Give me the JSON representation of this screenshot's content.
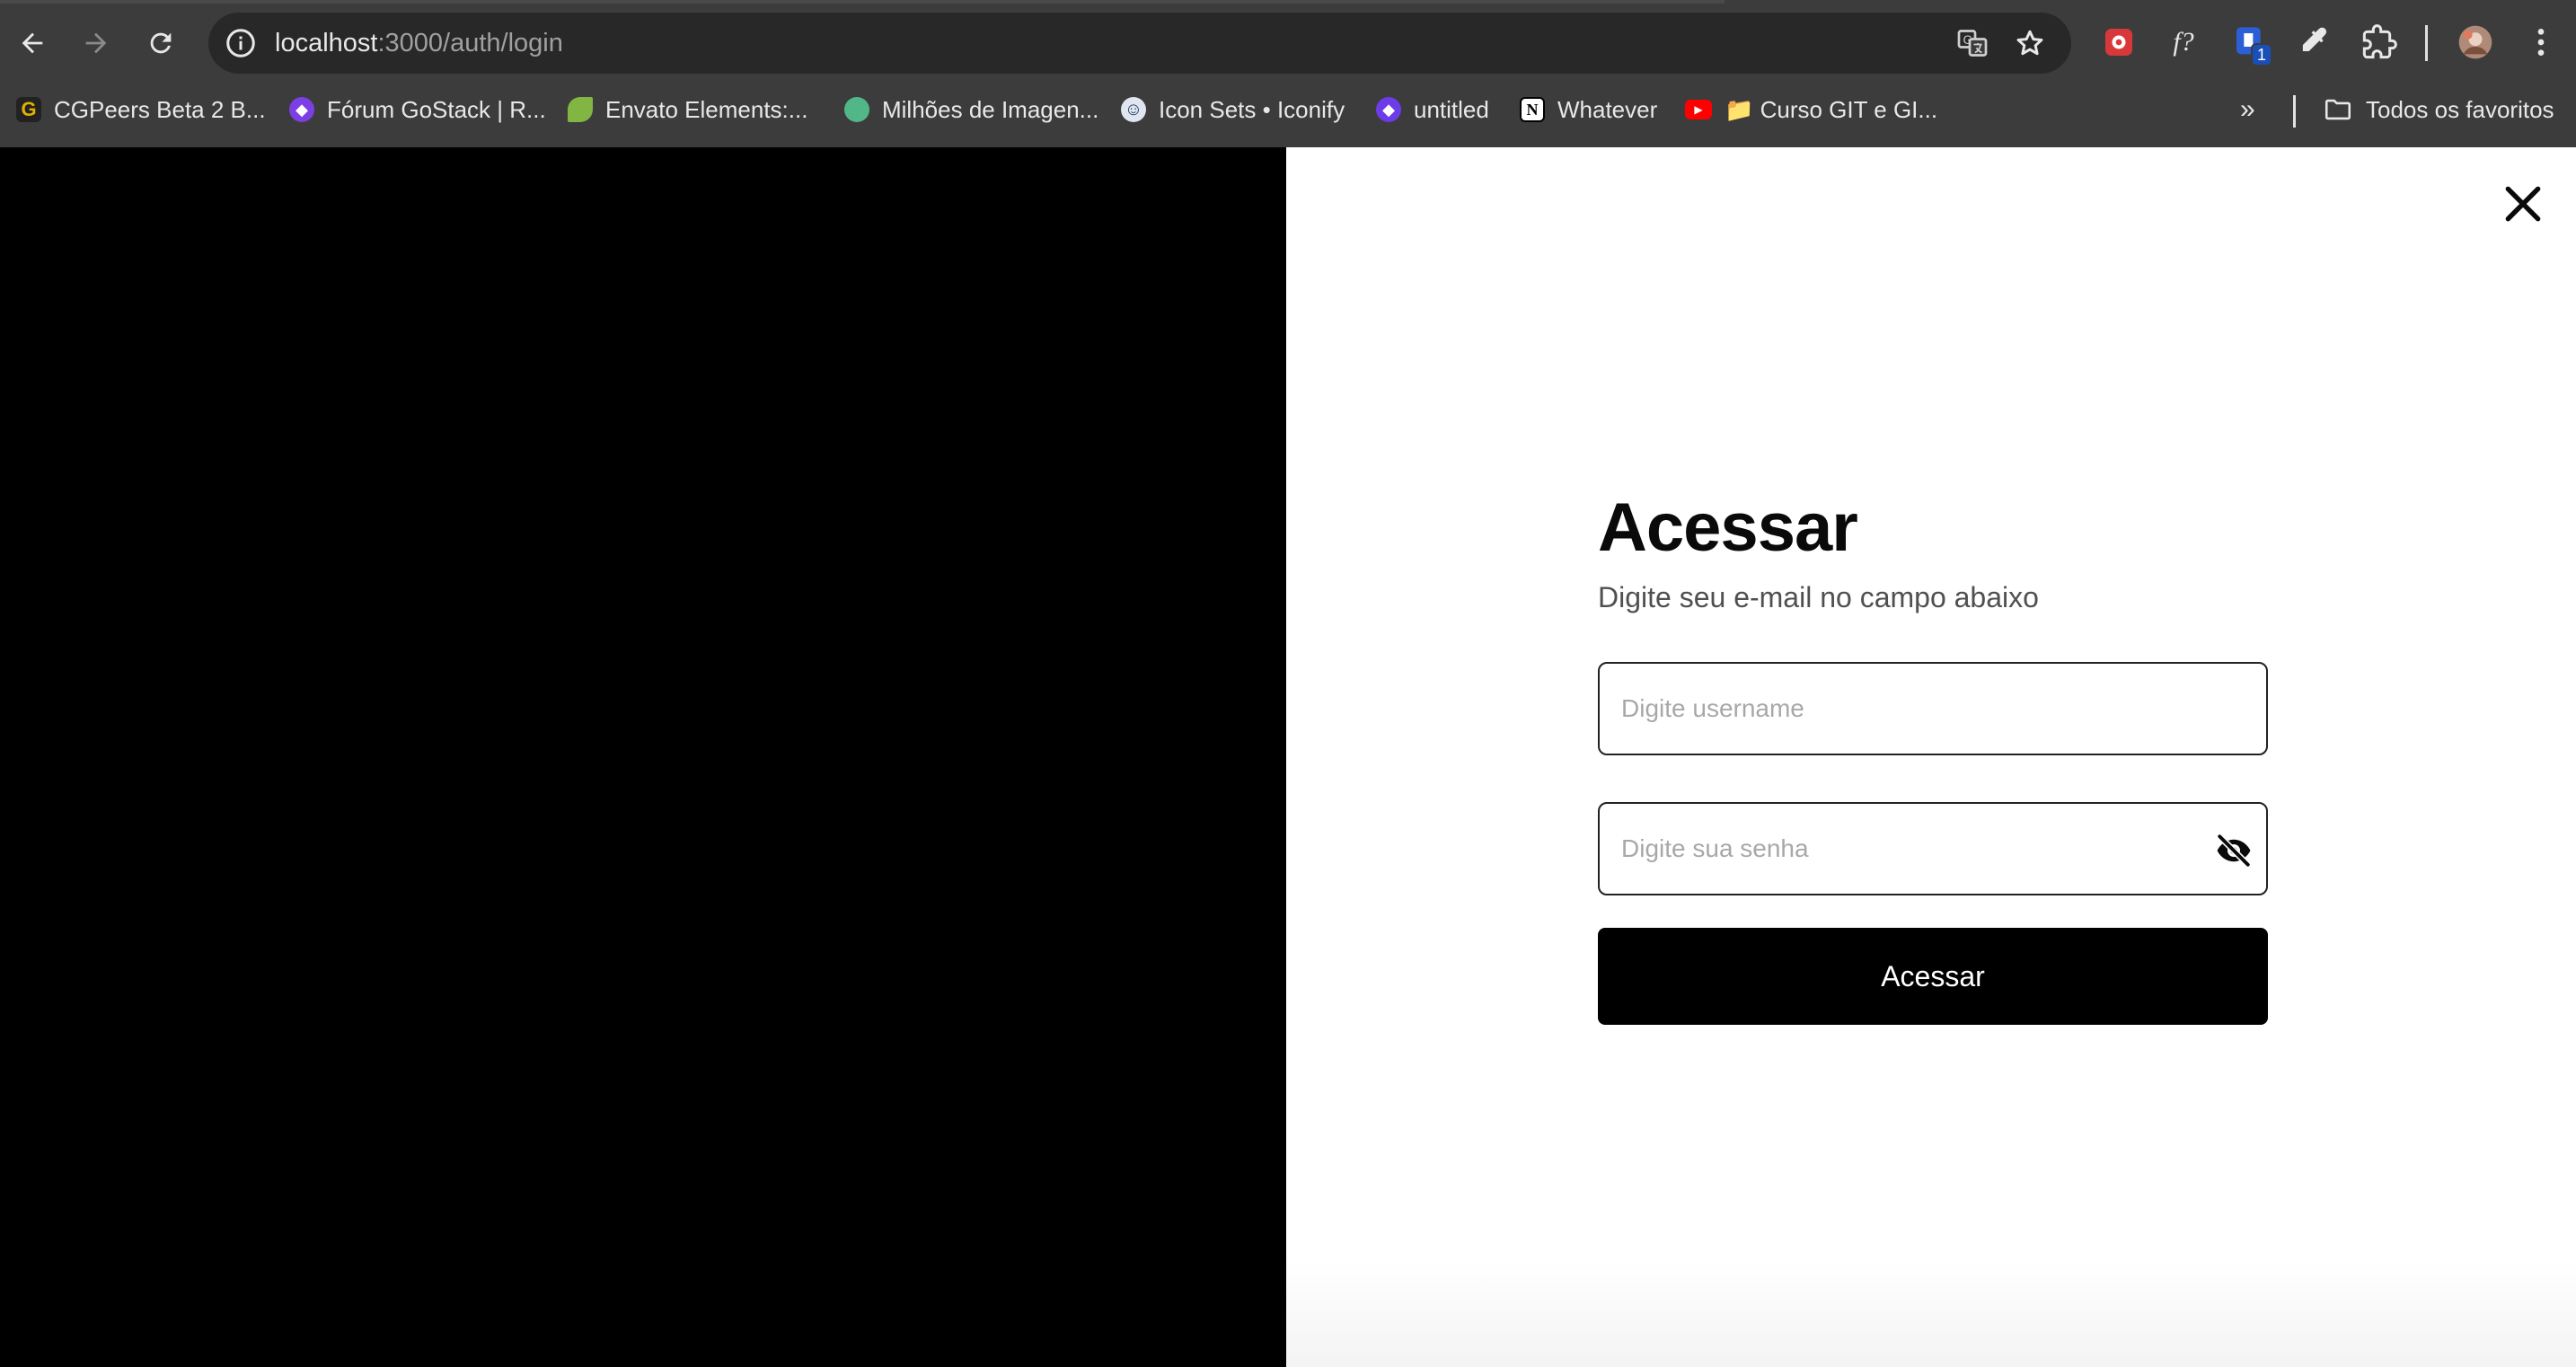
{
  "browser": {
    "url_host": "localhost",
    "url_path": ":3000/auth/login",
    "bookmarks": [
      {
        "label": "CGPeers Beta 2 B...",
        "icon": "cgpeers-favicon",
        "color": "#e0b000"
      },
      {
        "label": "Fórum GoStack | R...",
        "icon": "rocketseat-favicon",
        "color": "#7b3fe4"
      },
      {
        "label": "Envato Elements:...",
        "icon": "envato-leaf-favicon",
        "color": "#82b541"
      },
      {
        "label": "Milhões de Imagen...",
        "icon": "freepik-favicon",
        "color": "#52b788"
      },
      {
        "label": "Icon Sets • Iconify",
        "icon": "iconify-smiley-favicon",
        "color": "#dfe6f0"
      },
      {
        "label": "untitled",
        "icon": "linear-diamond-favicon",
        "color": "#6c3ce9"
      },
      {
        "label": "Whatever",
        "icon": "notion-favicon",
        "color": "#ffffff"
      },
      {
        "label": "📁 Curso GIT e GI...",
        "icon": "youtube-favicon",
        "color": "#ff0000"
      }
    ],
    "all_bookmarks_label": "Todos os favoritos",
    "extension_badge": "1",
    "formula_ext_label": "f?"
  },
  "login": {
    "title": "Acessar",
    "subtitle": "Digite seu e-mail no campo abaixo",
    "username_placeholder": "Digite username",
    "username_value": "",
    "password_placeholder": "Digite sua senha",
    "password_value": "",
    "submit_label": "Acessar"
  },
  "colors": {
    "left_panel": "#000000",
    "right_panel": "#ffffff",
    "button_bg": "#000000",
    "button_text": "#ffffff"
  }
}
